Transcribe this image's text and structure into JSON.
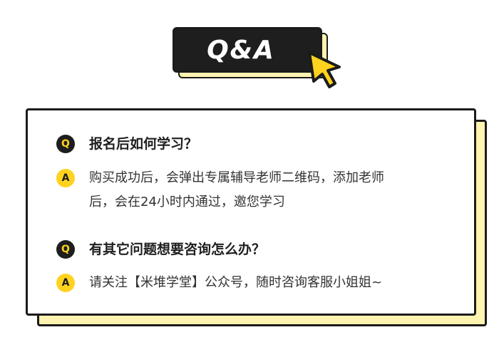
{
  "header": {
    "title": "Q&A",
    "cursor_icon": "pointer-hand-icon"
  },
  "colors": {
    "accent_yellow": "#ffd21f",
    "shadow_yellow": "#fff3b0",
    "dark": "#1e1e1e"
  },
  "qa": [
    {
      "q_badge": "Q",
      "question": "报名后如何学习？",
      "a_badge": "A",
      "answer_lines": [
        "购买成功后，会弹出专属辅导老师二维码，添加老师",
        "后，会在24小时内通过，邀您学习"
      ]
    },
    {
      "q_badge": "Q",
      "question": "有其它问题想要咨询怎么办？",
      "a_badge": "A",
      "answer_lines": [
        "请关注【米堆学堂】公众号，随时咨询客服小姐姐~"
      ]
    }
  ]
}
